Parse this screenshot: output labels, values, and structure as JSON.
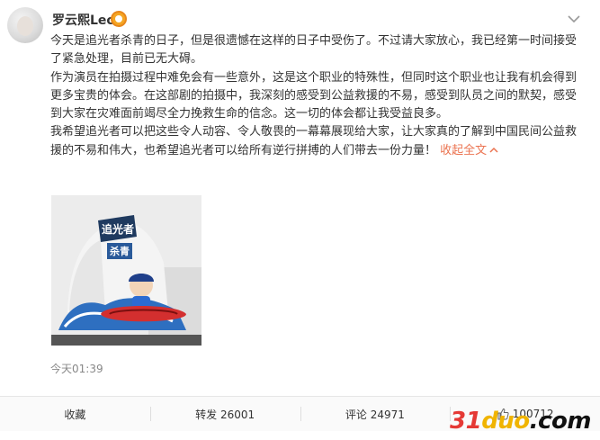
{
  "author": {
    "name": "罗云熙Leo"
  },
  "post": {
    "paragraphs": [
      "今天是追光者杀青的日子，但是很遗憾在这样的日子中受伤了。不过请大家放心，我已经第一时间接受了紧急处理，目前已无大碍。",
      "作为演员在拍摄过程中难免会有一些意外，这是这个职业的特殊性，但同时这个职业也让我有机会得到更多宝贵的体会。在这部剧的拍摄中，我深刻的感受到公益救援的不易，感受到队员之间的默契，感受到大家在灾难面前竭尽全力挽救生命的信念。这一切的体会都让我受益良多。",
      "我希望追光者可以把这些令人动容、令人敬畏的一幕幕展现给大家，让大家真的了解到中国民间公益救援的不易和伟大，也希望追光者可以给所有逆行拼搏的人们带去一份力量！"
    ],
    "collapse_label": "收起全文",
    "timestamp": "今天01:39"
  },
  "photo": {
    "cake_text_top": "追光者",
    "cake_text_badge": "杀青"
  },
  "actions": {
    "favorite": "收藏",
    "repost": "转发 26001",
    "comment": "评论 24971",
    "like": "100712"
  },
  "watermark": {
    "part1": "31",
    "part2": "duo",
    "part3": ".com"
  },
  "colors": {
    "link": "#eb7350",
    "verified": "#f5a623"
  }
}
